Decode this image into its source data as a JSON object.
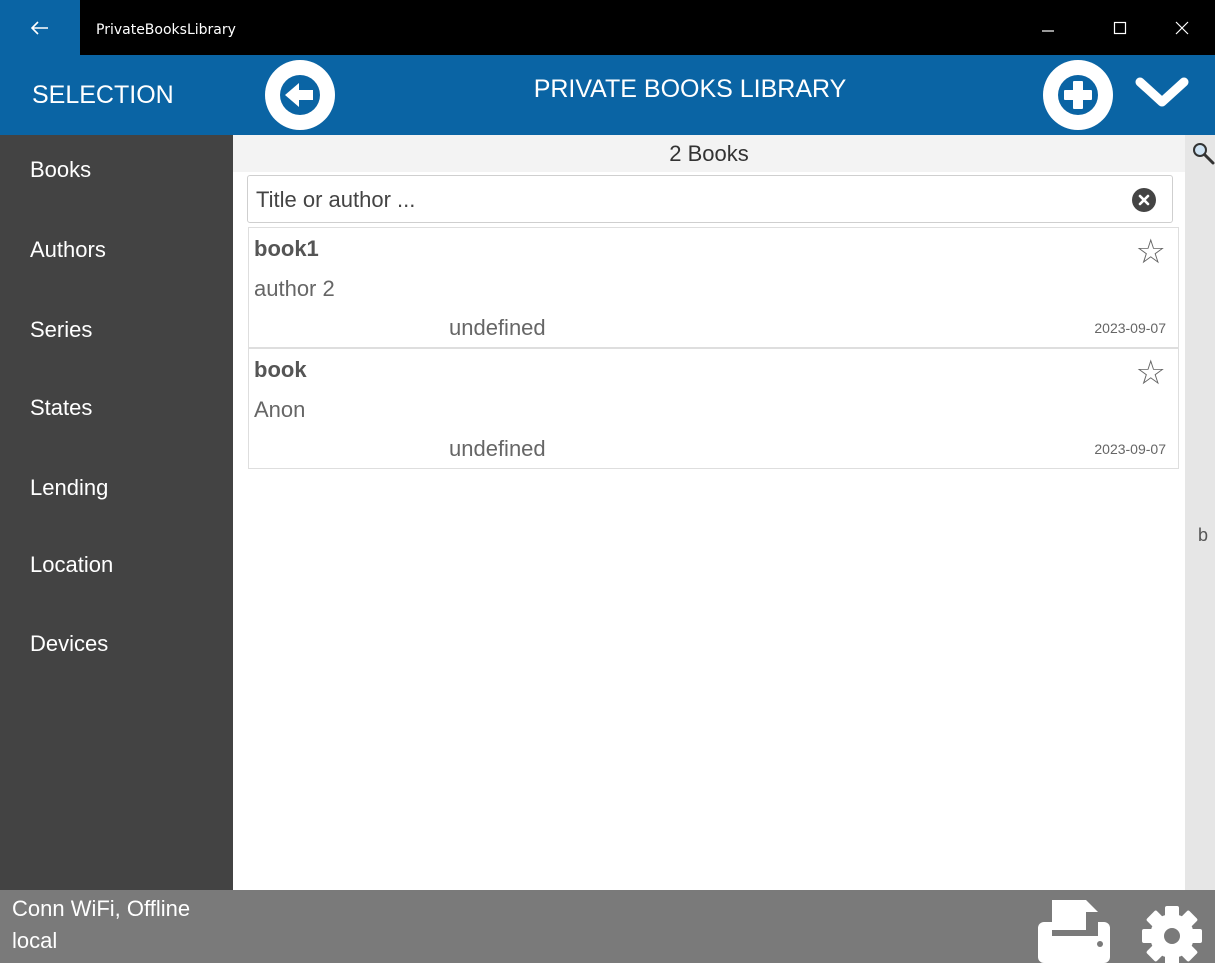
{
  "window": {
    "title": "PrivateBooksLibrary",
    "back_icon": "arrow-left-icon",
    "minimize_icon": "minimize-icon",
    "maximize_icon": "maximize-icon",
    "close_icon": "close-icon"
  },
  "header": {
    "selection_label": "SELECTION",
    "title": "PRIVATE BOOKS LIBRARY",
    "accent": "#0a64a4"
  },
  "sidebar": {
    "items": [
      {
        "label": "Books"
      },
      {
        "label": "Authors"
      },
      {
        "label": "Series"
      },
      {
        "label": "States"
      },
      {
        "label": "Lending"
      },
      {
        "label": "Location"
      },
      {
        "label": "Devices"
      }
    ]
  },
  "main": {
    "count": "2 Books",
    "search": {
      "placeholder": "Title or author ...",
      "value": ""
    },
    "books": [
      {
        "title": "book1",
        "author": "author 2",
        "state": "undefined",
        "date": "2023-09-07"
      },
      {
        "title": "book",
        "author": "Anon",
        "state": "undefined",
        "date": "2023-09-07"
      }
    ]
  },
  "index_strip": {
    "letter": "b"
  },
  "footer": {
    "connection": "Conn WiFi, Offline",
    "storage": "local"
  }
}
